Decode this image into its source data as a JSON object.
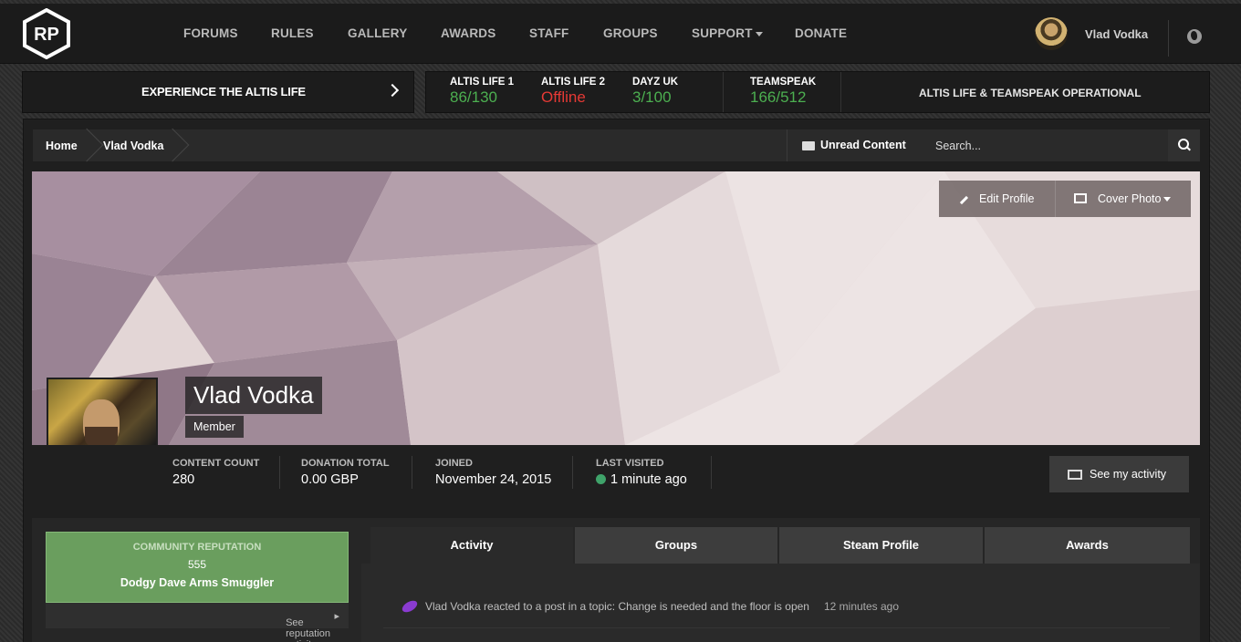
{
  "nav": {
    "logo": "RP",
    "items": [
      {
        "label": "FORUMS"
      },
      {
        "label": "RULES"
      },
      {
        "label": "GALLERY"
      },
      {
        "label": "AWARDS"
      },
      {
        "label": "STAFF"
      },
      {
        "label": "GROUPS"
      },
      {
        "label": "SUPPORT"
      },
      {
        "label": "DONATE"
      }
    ],
    "user": "Vlad Vodka",
    "globe_icon": "globe-icon"
  },
  "banner": {
    "experience": "EXPERIENCE THE ALTIS LIFE",
    "servers": [
      {
        "name": "ALTIS LIFE 1",
        "value": "86/130",
        "color": "#4caf50"
      },
      {
        "name": "ALTIS LIFE 2",
        "value": "Offline",
        "color": "#e53935"
      },
      {
        "name": "DAYZ UK",
        "value": "3/100",
        "color": "#4caf50"
      },
      {
        "name": "TEAMSPEAK",
        "value": "166/512",
        "color": "#4caf50"
      }
    ],
    "status": "ALTIS LIFE & TEAMSPEAK OPERATIONAL"
  },
  "breadcrumb": [
    "Home",
    "Vlad Vodka"
  ],
  "toolbar": {
    "unread": "Unread Content",
    "search_placeholder": "Search..."
  },
  "profile": {
    "name": "Vlad Vodka",
    "rank": "Member",
    "edit_label": "Edit Profile",
    "cover_label": "Cover Photo",
    "stats": [
      {
        "label": "CONTENT COUNT",
        "value": "280"
      },
      {
        "label": "DONATION TOTAL",
        "value": "0.00 GBP"
      },
      {
        "label": "JOINED",
        "value": "November 24, 2015"
      },
      {
        "label": "LAST VISITED",
        "value": "1 minute ago"
      }
    ],
    "see_activity": "See my activity"
  },
  "reputation": {
    "label": "COMMUNITY REPUTATION",
    "value": "555",
    "title": "Dodgy Dave Arms Smuggler",
    "link": "See reputation activity"
  },
  "tabs": [
    {
      "label": "Activity",
      "active": true
    },
    {
      "label": "Groups"
    },
    {
      "label": "Steam Profile"
    },
    {
      "label": "Awards"
    }
  ],
  "feed": [
    {
      "text": "Vlad Vodka reacted to a post in a topic: Change is needed and the floor is open",
      "time": "12 minutes ago"
    }
  ],
  "colors": {
    "accent": "#4caf50",
    "offline": "#e53935",
    "reputation": "#6a9e5e"
  }
}
